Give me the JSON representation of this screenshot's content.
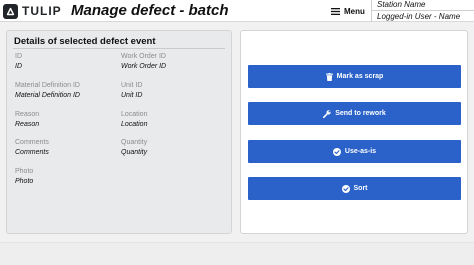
{
  "header": {
    "brand": "TULIP",
    "title": "Manage defect - batch",
    "menu_label": "Menu",
    "station_name": "Station Name",
    "user": "Logged-in User - Name"
  },
  "details": {
    "title": "Details of selected defect event",
    "fields": [
      {
        "label": "ID",
        "value": "ID"
      },
      {
        "label": "Work Order ID",
        "value": "Work Order ID"
      },
      {
        "label": "Material Definition ID",
        "value": "Material Definition ID"
      },
      {
        "label": "Unit ID",
        "value": "Unit ID"
      },
      {
        "label": "Reason",
        "value": "Reason"
      },
      {
        "label": "Location",
        "value": "Location"
      },
      {
        "label": "Comments",
        "value": "Comments"
      },
      {
        "label": "Quantity",
        "value": "Quantity"
      },
      {
        "label": "Photo",
        "value": "Photo"
      }
    ]
  },
  "actions": [
    {
      "label": "Mark as scrap",
      "icon": "trash-icon"
    },
    {
      "label": "Send to rework",
      "icon": "wrench-icon"
    },
    {
      "label": "Use-as-is",
      "icon": "check-circle-icon"
    },
    {
      "label": "Sort",
      "icon": "check-circle-icon"
    }
  ],
  "colors": {
    "accent": "#2a62c9",
    "background": "#f1f1f2",
    "panel": "#e9eaeb"
  }
}
